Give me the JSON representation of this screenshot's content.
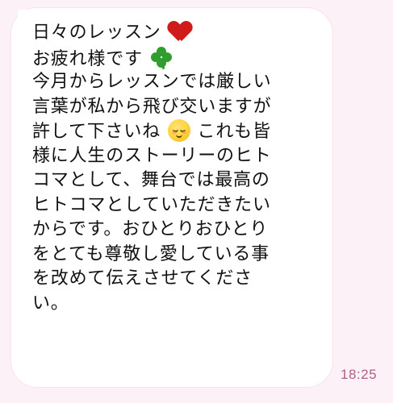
{
  "chat": {
    "message": {
      "line_1": "日々のレッスン",
      "line_2": "お疲れ様です",
      "line_3": "今月からレッスンでは厳しい",
      "line_4": "言葉が私から飛び交いますが",
      "line_5_before_emoji": "許して下さいね",
      "line_5_after_emoji": "これも皆",
      "line_6": "様に人生のストーリーのヒト",
      "line_7": "コマとして、舞台では最高の",
      "line_8": "ヒトコマとしていただきたい",
      "line_9": "からです。おひとりおひとり",
      "line_10": "をとても尊敬し愛している事",
      "line_11": "を改めて伝えさせてくださ",
      "line_12": "い。"
    },
    "emojis": {
      "heart": "red-heart-icon",
      "clover": "four-leaf-clover-icon",
      "relieved": "relieved-face-icon"
    },
    "timestamp": "18:25"
  },
  "colors": {
    "background": "#fcf1f6",
    "bubble": "#ffffff",
    "text": "#111111",
    "timestamp": "#b45f85"
  }
}
